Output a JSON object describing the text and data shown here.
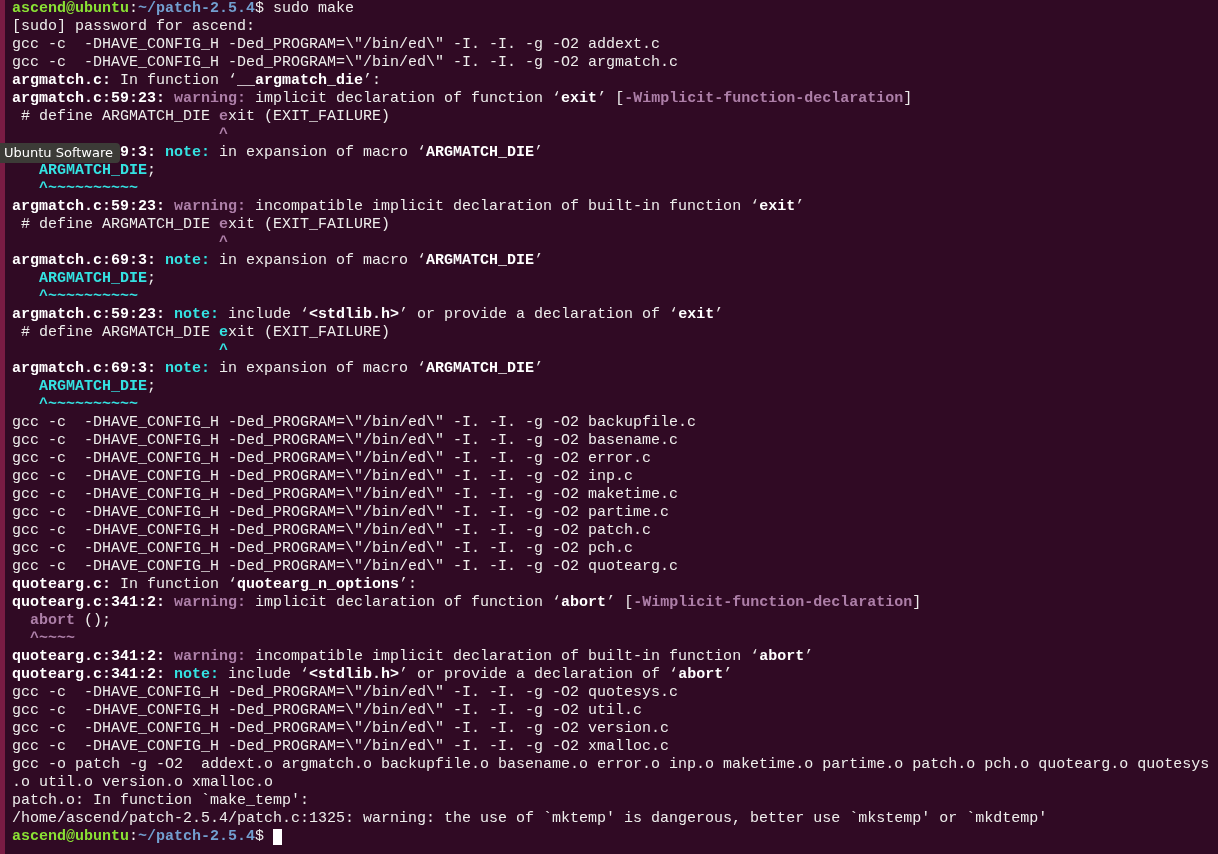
{
  "terminal": {
    "lines": [
      [
        {
          "kind": "user",
          "text": "ascend@ubuntu"
        },
        {
          "kind": "plain",
          "text": ":"
        },
        {
          "kind": "path",
          "text": "~/patch-2.5.4"
        },
        {
          "kind": "plain",
          "text": "$ sudo make"
        }
      ],
      [
        {
          "kind": "plain",
          "text": "[sudo] password for ascend:"
        }
      ],
      [
        {
          "kind": "plain",
          "text": "gcc -c  -DHAVE_CONFIG_H -Ded_PROGRAM=\\\"/bin/ed\\\" -I. -I. -g -O2 addext.c"
        }
      ],
      [
        {
          "kind": "plain",
          "text": "gcc -c  -DHAVE_CONFIG_H -Ded_PROGRAM=\\\"/bin/ed\\\" -I. -I. -g -O2 argmatch.c"
        }
      ],
      [
        {
          "kind": "bold",
          "text": "argmatch.c:"
        },
        {
          "kind": "plain",
          "text": " In function ‘"
        },
        {
          "kind": "bold",
          "text": "__argmatch_die"
        },
        {
          "kind": "plain",
          "text": "’:"
        }
      ],
      [
        {
          "kind": "bold",
          "text": "argmatch.c:59:23:"
        },
        {
          "kind": "warn",
          "text": " warning:"
        },
        {
          "kind": "plain",
          "text": " implicit declaration of function ‘"
        },
        {
          "kind": "bold",
          "text": "exit"
        },
        {
          "kind": "plain",
          "text": "’ ["
        },
        {
          "kind": "warn",
          "text": "-Wimplicit-function-declaration"
        },
        {
          "kind": "plain",
          "text": "]"
        }
      ],
      [
        {
          "kind": "plain",
          "text": " # define ARGMATCH_DIE "
        },
        {
          "kind": "warn",
          "text": "e"
        },
        {
          "kind": "plain",
          "text": "xit (EXIT_FAILURE)"
        }
      ],
      [
        {
          "kind": "warn",
          "text": "                       ^"
        }
      ],
      [
        {
          "kind": "tooltip",
          "text": "Ubuntu Software"
        },
        {
          "kind": "bold",
          "text": "9:3:"
        },
        {
          "kind": "note",
          "text": " note:"
        },
        {
          "kind": "plain",
          "text": " in expansion of macro ‘"
        },
        {
          "kind": "bold",
          "text": "ARGMATCH_DIE"
        },
        {
          "kind": "plain",
          "text": "’"
        }
      ],
      [
        {
          "kind": "note",
          "text": "   ARGMATCH_DIE"
        },
        {
          "kind": "plain",
          "text": ";"
        }
      ],
      [
        {
          "kind": "note",
          "text": "   ^~~~~~~~~~~"
        }
      ],
      [
        {
          "kind": "bold",
          "text": "argmatch.c:59:23:"
        },
        {
          "kind": "warn",
          "text": " warning:"
        },
        {
          "kind": "plain",
          "text": " incompatible implicit declaration of built-in function ‘"
        },
        {
          "kind": "bold",
          "text": "exit"
        },
        {
          "kind": "plain",
          "text": "’"
        }
      ],
      [
        {
          "kind": "plain",
          "text": " # define ARGMATCH_DIE "
        },
        {
          "kind": "warn",
          "text": "e"
        },
        {
          "kind": "plain",
          "text": "xit (EXIT_FAILURE)"
        }
      ],
      [
        {
          "kind": "warn",
          "text": "                       ^"
        }
      ],
      [
        {
          "kind": "bold",
          "text": "argmatch.c:69:3:"
        },
        {
          "kind": "note",
          "text": " note:"
        },
        {
          "kind": "plain",
          "text": " in expansion of macro ‘"
        },
        {
          "kind": "bold",
          "text": "ARGMATCH_DIE"
        },
        {
          "kind": "plain",
          "text": "’"
        }
      ],
      [
        {
          "kind": "note",
          "text": "   ARGMATCH_DIE"
        },
        {
          "kind": "plain",
          "text": ";"
        }
      ],
      [
        {
          "kind": "note",
          "text": "   ^~~~~~~~~~~"
        }
      ],
      [
        {
          "kind": "bold",
          "text": "argmatch.c:59:23:"
        },
        {
          "kind": "note",
          "text": " note:"
        },
        {
          "kind": "plain",
          "text": " include ‘"
        },
        {
          "kind": "bold",
          "text": "<stdlib.h>"
        },
        {
          "kind": "plain",
          "text": "’ or provide a declaration of ‘"
        },
        {
          "kind": "bold",
          "text": "exit"
        },
        {
          "kind": "plain",
          "text": "’"
        }
      ],
      [
        {
          "kind": "plain",
          "text": " # define ARGMATCH_DIE "
        },
        {
          "kind": "note",
          "text": "e"
        },
        {
          "kind": "plain",
          "text": "xit (EXIT_FAILURE)"
        }
      ],
      [
        {
          "kind": "note",
          "text": "                       ^"
        }
      ],
      [
        {
          "kind": "bold",
          "text": "argmatch.c:69:3:"
        },
        {
          "kind": "note",
          "text": " note:"
        },
        {
          "kind": "plain",
          "text": " in expansion of macro ‘"
        },
        {
          "kind": "bold",
          "text": "ARGMATCH_DIE"
        },
        {
          "kind": "plain",
          "text": "’"
        }
      ],
      [
        {
          "kind": "note",
          "text": "   ARGMATCH_DIE"
        },
        {
          "kind": "plain",
          "text": ";"
        }
      ],
      [
        {
          "kind": "note",
          "text": "   ^~~~~~~~~~~"
        }
      ],
      [
        {
          "kind": "plain",
          "text": "gcc -c  -DHAVE_CONFIG_H -Ded_PROGRAM=\\\"/bin/ed\\\" -I. -I. -g -O2 backupfile.c"
        }
      ],
      [
        {
          "kind": "plain",
          "text": "gcc -c  -DHAVE_CONFIG_H -Ded_PROGRAM=\\\"/bin/ed\\\" -I. -I. -g -O2 basename.c"
        }
      ],
      [
        {
          "kind": "plain",
          "text": "gcc -c  -DHAVE_CONFIG_H -Ded_PROGRAM=\\\"/bin/ed\\\" -I. -I. -g -O2 error.c"
        }
      ],
      [
        {
          "kind": "plain",
          "text": "gcc -c  -DHAVE_CONFIG_H -Ded_PROGRAM=\\\"/bin/ed\\\" -I. -I. -g -O2 inp.c"
        }
      ],
      [
        {
          "kind": "plain",
          "text": "gcc -c  -DHAVE_CONFIG_H -Ded_PROGRAM=\\\"/bin/ed\\\" -I. -I. -g -O2 maketime.c"
        }
      ],
      [
        {
          "kind": "plain",
          "text": "gcc -c  -DHAVE_CONFIG_H -Ded_PROGRAM=\\\"/bin/ed\\\" -I. -I. -g -O2 partime.c"
        }
      ],
      [
        {
          "kind": "plain",
          "text": "gcc -c  -DHAVE_CONFIG_H -Ded_PROGRAM=\\\"/bin/ed\\\" -I. -I. -g -O2 patch.c"
        }
      ],
      [
        {
          "kind": "plain",
          "text": "gcc -c  -DHAVE_CONFIG_H -Ded_PROGRAM=\\\"/bin/ed\\\" -I. -I. -g -O2 pch.c"
        }
      ],
      [
        {
          "kind": "plain",
          "text": "gcc -c  -DHAVE_CONFIG_H -Ded_PROGRAM=\\\"/bin/ed\\\" -I. -I. -g -O2 quotearg.c"
        }
      ],
      [
        {
          "kind": "bold",
          "text": "quotearg.c:"
        },
        {
          "kind": "plain",
          "text": " In function ‘"
        },
        {
          "kind": "bold",
          "text": "quotearg_n_options"
        },
        {
          "kind": "plain",
          "text": "’:"
        }
      ],
      [
        {
          "kind": "bold",
          "text": "quotearg.c:341:2:"
        },
        {
          "kind": "warn",
          "text": " warning:"
        },
        {
          "kind": "plain",
          "text": " implicit declaration of function ‘"
        },
        {
          "kind": "bold",
          "text": "abort"
        },
        {
          "kind": "plain",
          "text": "’ ["
        },
        {
          "kind": "warn",
          "text": "-Wimplicit-function-declaration"
        },
        {
          "kind": "plain",
          "text": "]"
        }
      ],
      [
        {
          "kind": "warn",
          "text": "  abort"
        },
        {
          "kind": "plain",
          "text": " ();"
        }
      ],
      [
        {
          "kind": "warn",
          "text": "  ^~~~~"
        }
      ],
      [
        {
          "kind": "bold",
          "text": "quotearg.c:341:2:"
        },
        {
          "kind": "warn",
          "text": " warning:"
        },
        {
          "kind": "plain",
          "text": " incompatible implicit declaration of built-in function ‘"
        },
        {
          "kind": "bold",
          "text": "abort"
        },
        {
          "kind": "plain",
          "text": "’"
        }
      ],
      [
        {
          "kind": "bold",
          "text": "quotearg.c:341:2:"
        },
        {
          "kind": "note",
          "text": " note:"
        },
        {
          "kind": "plain",
          "text": " include ‘"
        },
        {
          "kind": "bold",
          "text": "<stdlib.h>"
        },
        {
          "kind": "plain",
          "text": "’ or provide a declaration of ‘"
        },
        {
          "kind": "bold",
          "text": "abort"
        },
        {
          "kind": "plain",
          "text": "’"
        }
      ],
      [
        {
          "kind": "plain",
          "text": "gcc -c  -DHAVE_CONFIG_H -Ded_PROGRAM=\\\"/bin/ed\\\" -I. -I. -g -O2 quotesys.c"
        }
      ],
      [
        {
          "kind": "plain",
          "text": "gcc -c  -DHAVE_CONFIG_H -Ded_PROGRAM=\\\"/bin/ed\\\" -I. -I. -g -O2 util.c"
        }
      ],
      [
        {
          "kind": "plain",
          "text": "gcc -c  -DHAVE_CONFIG_H -Ded_PROGRAM=\\\"/bin/ed\\\" -I. -I. -g -O2 version.c"
        }
      ],
      [
        {
          "kind": "plain",
          "text": "gcc -c  -DHAVE_CONFIG_H -Ded_PROGRAM=\\\"/bin/ed\\\" -I. -I. -g -O2 xmalloc.c"
        }
      ],
      [
        {
          "kind": "plain",
          "text": "gcc -o patch -g -O2  addext.o argmatch.o backupfile.o basename.o error.o inp.o maketime.o partime.o patch.o pch.o quotearg.o quotesys"
        }
      ],
      [
        {
          "kind": "plain",
          "text": ".o util.o version.o xmalloc.o"
        }
      ],
      [
        {
          "kind": "plain",
          "text": "patch.o: In function `make_temp':"
        }
      ],
      [
        {
          "kind": "plain",
          "text": "/home/ascend/patch-2.5.4/patch.c:1325: warning: the use of `mktemp' is dangerous, better use `mkstemp' or `mkdtemp'"
        }
      ],
      [
        {
          "kind": "user",
          "text": "ascend@ubuntu"
        },
        {
          "kind": "plain",
          "text": ":"
        },
        {
          "kind": "path",
          "text": "~/patch-2.5.4"
        },
        {
          "kind": "plain",
          "text": "$ "
        }
      ]
    ]
  }
}
